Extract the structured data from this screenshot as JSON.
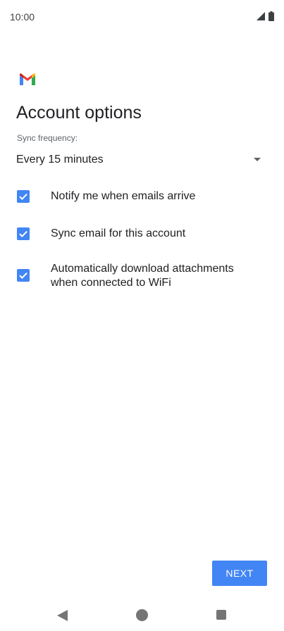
{
  "status_bar": {
    "time": "10:00",
    "icons": [
      "signal-icon",
      "battery-icon"
    ]
  },
  "app": {
    "logo": "gmail-logo-icon"
  },
  "title": "Account options",
  "sync": {
    "label": "Sync frequency:",
    "value": "Every 15 minutes"
  },
  "options": [
    {
      "label": "Notify me when emails arrive",
      "checked": true
    },
    {
      "label": "Sync email for this account",
      "checked": true
    },
    {
      "label": "Automatically download attachments when connected to WiFi",
      "checked": true
    }
  ],
  "next_button": {
    "label": "NEXT"
  },
  "nav_bar": {
    "icons": [
      "back-icon",
      "home-icon",
      "recents-icon"
    ]
  },
  "colors": {
    "accent": "#4285f4",
    "text": "#202124",
    "secondary_text": "#5f6368"
  }
}
